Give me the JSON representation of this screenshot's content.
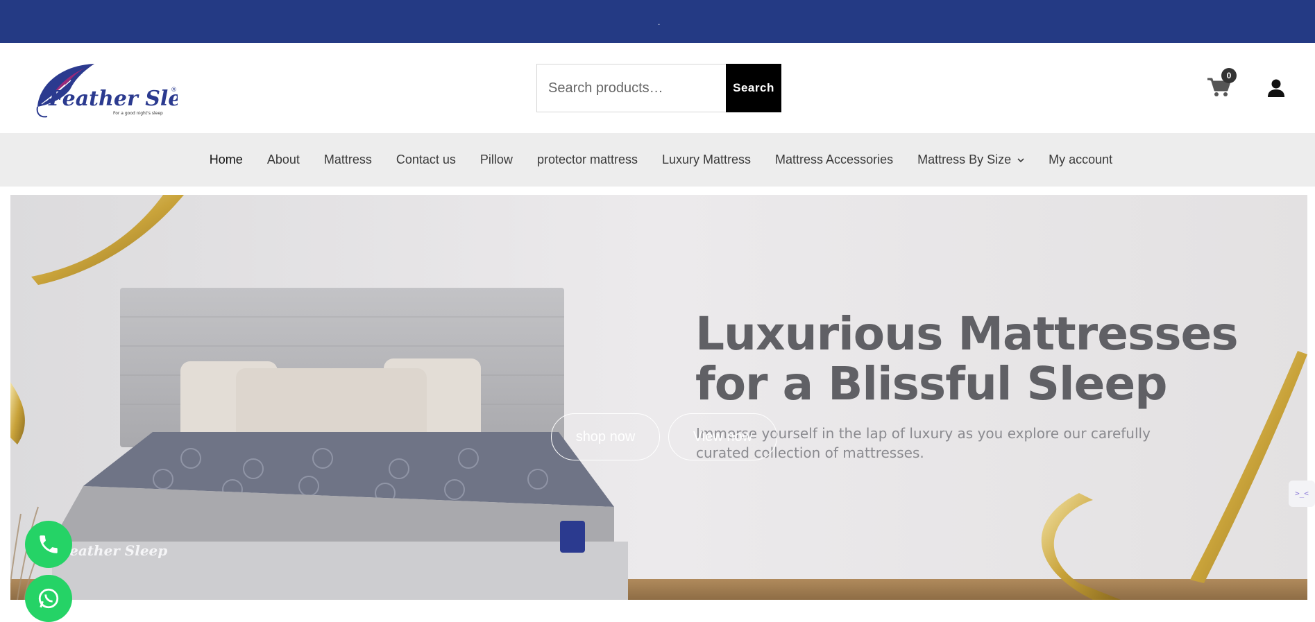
{
  "topbar": {
    "text": "."
  },
  "brand": {
    "name": "Feather Sleep",
    "tagline": "For a good night's sleep",
    "registered": "®"
  },
  "search": {
    "placeholder": "Search products…",
    "button_label": "Search"
  },
  "cart": {
    "count": "0"
  },
  "nav": {
    "items": [
      {
        "label": "Home",
        "active": true
      },
      {
        "label": "About"
      },
      {
        "label": "Mattress"
      },
      {
        "label": "Contact us"
      },
      {
        "label": "Pillow"
      },
      {
        "label": "protector mattress"
      },
      {
        "label": "Luxury Mattress"
      },
      {
        "label": "Mattress Accessories"
      },
      {
        "label": "Mattress By Size",
        "has_dropdown": true
      },
      {
        "label": "My account"
      }
    ]
  },
  "hero": {
    "title_line1": "Luxurious Mattresses",
    "title_line2": "for a Blissful Sleep",
    "subtitle_line1": "Immerse yourself in the lap of luxury as you explore our carefully",
    "subtitle_line2": "curated collection of mattresses.",
    "mattress_brand": "Feather Sleep",
    "btn_shop": "shop now",
    "btn_view": "View now"
  },
  "widget": {
    "text": ">_<"
  },
  "colors": {
    "topbar": "#243a84",
    "nav_bg": "#ededed",
    "whatsapp": "#25d366",
    "search_btn": "#000000"
  },
  "icons": [
    "cart-icon",
    "user-icon",
    "chevron-down-icon",
    "phone-icon",
    "whatsapp-icon"
  ]
}
